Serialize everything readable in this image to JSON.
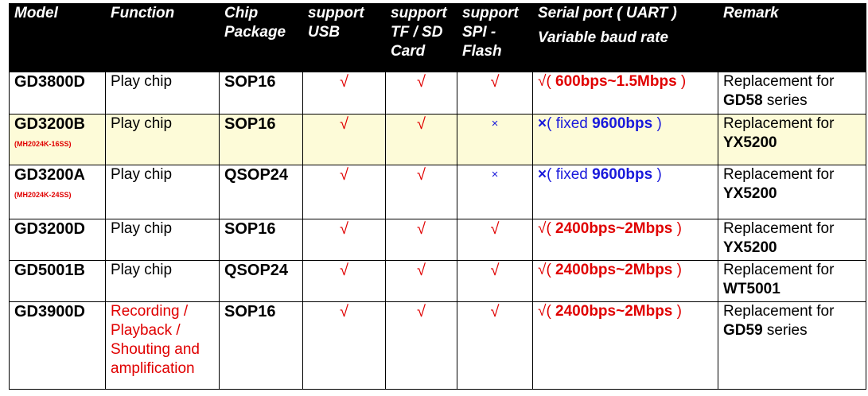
{
  "headers": {
    "model": "Model",
    "function": "Function",
    "chip_package_1": "Chip",
    "chip_package_2": "Package",
    "usb_1": "support",
    "usb_2": "USB",
    "tf_1": "support",
    "tf_2": "TF / SD",
    "tf_3": "Card",
    "spi_1": "support",
    "spi_2": "SPI -",
    "spi_3": "Flash",
    "uart_1": "Serial port ( UART )",
    "uart_2": "Variable baud rate",
    "remark": "Remark"
  },
  "marks": {
    "check": "√",
    "cross": "×"
  },
  "colors": {
    "header_bg": "#000000",
    "red": "#e00000",
    "blue": "#1a1adb",
    "highlight_row": "#fdfbd8"
  },
  "rows": [
    {
      "model": "GD3800D",
      "model_sub": "",
      "function": [
        "Play chip"
      ],
      "function_red": false,
      "package": "SOP16",
      "usb": "√",
      "tf": "√",
      "spi": "√",
      "uart_mark": "√",
      "uart_open": "(",
      "uart_prefix": "",
      "uart_value": "600bps~1.5Mbps",
      "uart_close": ")",
      "uart_color": "red",
      "remark_line1": "Replacement for",
      "remark_bold": "GD58",
      "remark_rest": " series"
    },
    {
      "model": "GD3200B",
      "model_sub": "(MH2024K-16SS)",
      "function": [
        "Play chip"
      ],
      "function_red": false,
      "package": "SOP16",
      "usb": "√",
      "tf": "√",
      "spi": "×",
      "uart_mark": "×",
      "uart_open": "(",
      "uart_prefix": "fixed ",
      "uart_value": "9600bps",
      "uart_close": ")",
      "uart_color": "blue",
      "remark_line1": "Replacement for",
      "remark_bold": "YX5200",
      "remark_rest": ""
    },
    {
      "model": "GD3200A",
      "model_sub": "(MH2024K-24SS)",
      "function": [
        "Play chip"
      ],
      "function_red": false,
      "package": "QSOP24",
      "usb": "√",
      "tf": "√",
      "spi": "×",
      "uart_mark": "×",
      "uart_open": "(",
      "uart_prefix": "fixed ",
      "uart_value": "9600bps",
      "uart_close": ")",
      "uart_color": "blue",
      "remark_line1": "Replacement for",
      "remark_bold": "YX5200",
      "remark_rest": ""
    },
    {
      "model": "GD3200D",
      "model_sub": "",
      "function": [
        "Play chip"
      ],
      "function_red": false,
      "package": "SOP16",
      "usb": "√",
      "tf": "√",
      "spi": "√",
      "uart_mark": "√",
      "uart_open": "(",
      "uart_prefix": "",
      "uart_value": "2400bps~2Mbps",
      "uart_close": ")",
      "uart_color": "red",
      "remark_line1": "Replacement for",
      "remark_bold": "YX5200",
      "remark_rest": ""
    },
    {
      "model": "GD5001B",
      "model_sub": "",
      "function": [
        "Play chip"
      ],
      "function_red": false,
      "package": "QSOP24",
      "usb": "√",
      "tf": "√",
      "spi": "√",
      "uart_mark": "√",
      "uart_open": "(",
      "uart_prefix": "",
      "uart_value": "2400bps~2Mbps",
      "uart_close": ")",
      "uart_color": "red",
      "remark_line1": "Replacement for",
      "remark_bold": "WT5001",
      "remark_rest": ""
    },
    {
      "model": "GD3900D",
      "model_sub": "",
      "function": [
        "Recording /",
        "Playback /",
        "Shouting and",
        "amplification"
      ],
      "function_red": true,
      "package": "SOP16",
      "usb": "√",
      "tf": "√",
      "spi": "√",
      "uart_mark": "√",
      "uart_open": "(",
      "uart_prefix": "",
      "uart_value": "2400bps~2Mbps",
      "uart_close": ")",
      "uart_color": "red",
      "remark_line1": "Replacement for",
      "remark_bold": "GD59",
      "remark_rest": " series"
    }
  ]
}
